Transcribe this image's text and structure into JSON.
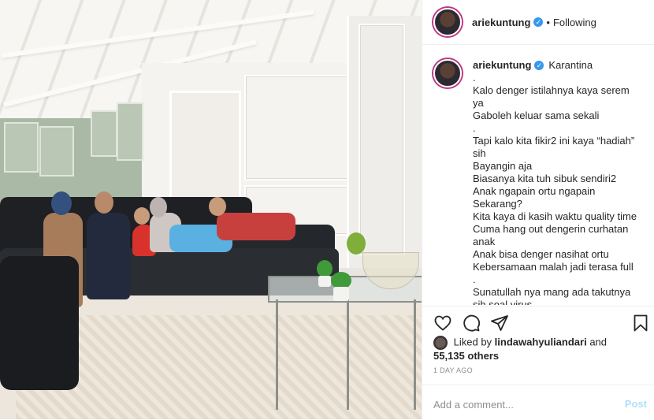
{
  "photo": {
    "description_icon": "family-living-room-photo"
  },
  "header": {
    "username": "ariekuntung",
    "verified_icon": "verified-badge-icon",
    "separator": "•",
    "follow_status": "Following"
  },
  "caption": {
    "username": "ariekuntung",
    "title": "Karantina",
    "lines": [
      ".",
      "Kalo denger istilahnya kaya serem ya",
      "Gaboleh keluar sama sekali",
      ".",
      "Tapi kalo kita fikir2 ini kaya “hadiah” sih",
      "Bayangin aja",
      "Biasanya kita tuh sibuk sendiri2",
      "Anak ngapain ortu ngapain",
      "Sekarang?",
      "Kita kaya di kasih waktu quality time",
      "Cuma hang out dengerin curhatan anak",
      "Anak bisa denger nasihat ortu",
      "Kebersamaan malah jadi terasa full",
      ".",
      "Sunatullah nya mang ada takutnya sih soal virus"
    ]
  },
  "actions": {
    "like_icon": "heart-icon",
    "comment_icon": "comment-icon",
    "share_icon": "paper-plane-icon",
    "save_icon": "bookmark-icon"
  },
  "likes": {
    "prefix": "Liked by",
    "liker": "lindawahyuliandari",
    "conjunction": "and",
    "count": "55,135 others"
  },
  "timestamp": "1 DAY AGO",
  "comment": {
    "placeholder": "Add a comment...",
    "post_label": "Post"
  },
  "colors": {
    "verified": "#3897f0",
    "post_button": "#b2dffc",
    "muted_text": "#8e8e8e",
    "story_ring": "#c13584"
  }
}
